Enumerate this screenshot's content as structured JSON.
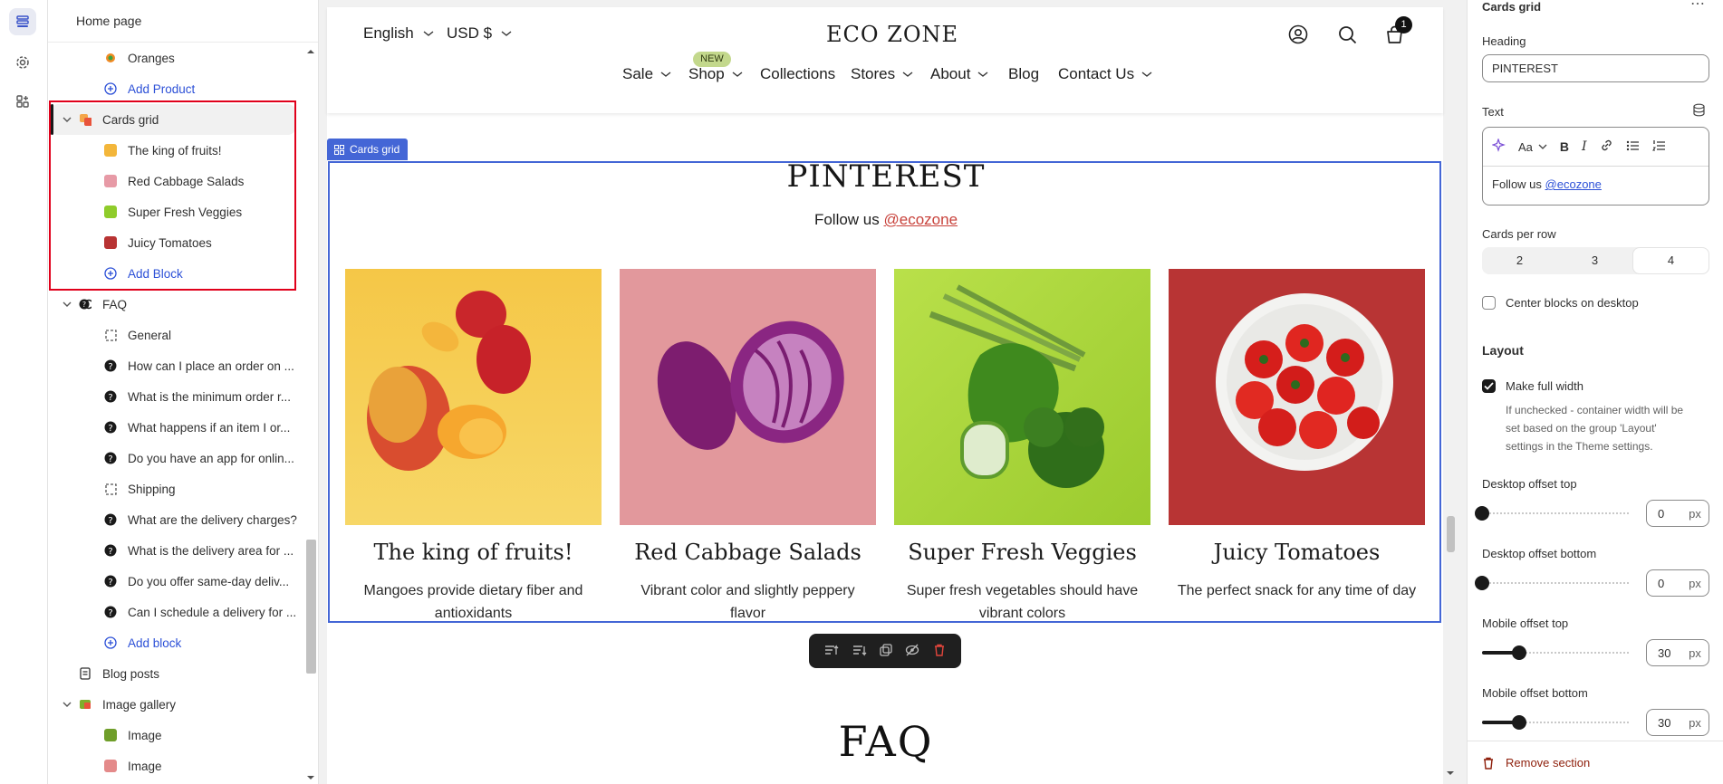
{
  "sidebar": {
    "title": "Home page",
    "items": [
      {
        "label": "Oranges"
      },
      {
        "label": "Add Product"
      },
      {
        "label": "Cards grid"
      },
      {
        "label": "The king of fruits!"
      },
      {
        "label": "Red Cabbage Salads"
      },
      {
        "label": "Super Fresh Veggies"
      },
      {
        "label": "Juicy Tomatoes"
      },
      {
        "label": "Add Block"
      },
      {
        "label": "FAQ"
      },
      {
        "label": "General"
      },
      {
        "label": "How can I place an order on ..."
      },
      {
        "label": "What is the minimum order r..."
      },
      {
        "label": "What happens if an item I or..."
      },
      {
        "label": "Do you have an app for onlin..."
      },
      {
        "label": "Shipping"
      },
      {
        "label": "What are the delivery charges?"
      },
      {
        "label": "What is the delivery area for ..."
      },
      {
        "label": "Do you offer same-day deliv..."
      },
      {
        "label": "Can I schedule a delivery for ..."
      },
      {
        "label": "Add block"
      },
      {
        "label": "Blog posts"
      },
      {
        "label": "Image gallery"
      },
      {
        "label": "Image"
      },
      {
        "label": "Image"
      }
    ]
  },
  "store": {
    "language": "English",
    "currency": "USD $",
    "logo": "ECO ZONE",
    "cart_count": "1",
    "new_badge": "NEW",
    "nav": [
      "Sale",
      "Shop",
      "Collections",
      "Stores",
      "About",
      "Blog",
      "Contact Us"
    ]
  },
  "section": {
    "tag": "Cards grid",
    "heading": "PINTEREST",
    "follow_text": "Follow us",
    "follow_link": "@ecozone",
    "cards": [
      {
        "title": "The king of fruits!",
        "text1": "Mangoes provide dietary fiber and",
        "text2": "antioxidants"
      },
      {
        "title": "Red Cabbage Salads",
        "text1": "Vibrant color and slightly peppery",
        "text2": "flavor"
      },
      {
        "title": "Super Fresh Veggies",
        "text1": "Super fresh vegetables should have",
        "text2": "vibrant colors"
      },
      {
        "title": "Juicy Tomatoes",
        "text1": "The perfect snack for any time of day",
        "text2": ""
      }
    ],
    "next_heading": "FAQ"
  },
  "panel": {
    "title": "Cards grid",
    "heading_label": "Heading",
    "heading_value": "PINTEREST",
    "text_label": "Text",
    "text_value": "Follow us",
    "text_link": "@ecozone",
    "cards_per_row_label": "Cards per row",
    "cards_per_row_options": [
      "2",
      "3",
      "4"
    ],
    "cards_per_row_selected": "4",
    "center_label": "Center blocks on desktop",
    "center_checked": false,
    "layout_label": "Layout",
    "full_width_label": "Make full width",
    "full_width_checked": true,
    "full_width_help1": "If unchecked - container width will be",
    "full_width_help2": "set based on the group 'Layout'",
    "full_width_help3": "settings in the Theme settings.",
    "offsets": [
      {
        "label": "Desktop offset top",
        "value": "0",
        "unit": "px",
        "fraction": 0
      },
      {
        "label": "Desktop offset bottom",
        "value": "0",
        "unit": "px",
        "fraction": 0
      },
      {
        "label": "Mobile offset top",
        "value": "30",
        "unit": "px",
        "fraction": 0.25
      },
      {
        "label": "Mobile offset bottom",
        "value": "30",
        "unit": "px",
        "fraction": 0.25
      }
    ],
    "remove_label": "Remove section"
  },
  "colors": {
    "accent": "#4466d6",
    "link": "#2c50d7",
    "highlight": "#e0001b",
    "danger": "#8e1f0b"
  }
}
